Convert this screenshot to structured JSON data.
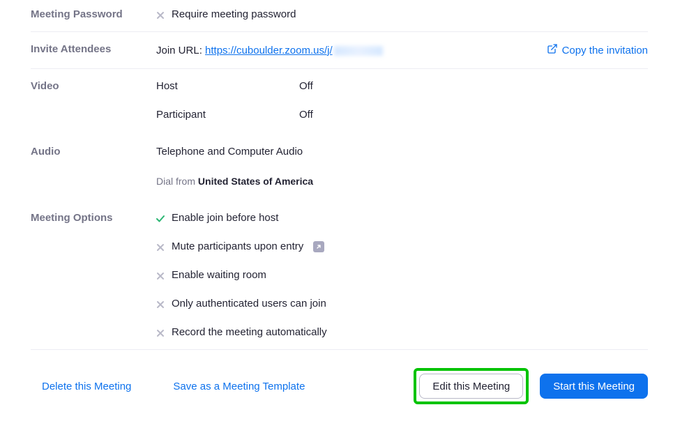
{
  "sections": {
    "meeting_password": {
      "label": "Meeting Password",
      "option": "Require meeting password"
    },
    "invite": {
      "label": "Invite Attendees",
      "join_url_label": "Join URL:",
      "join_url_visible": "https://cuboulder.zoom.us/j/",
      "copy_label": "Copy the invitation"
    },
    "video": {
      "label": "Video",
      "host_label": "Host",
      "host_value": "Off",
      "participant_label": "Participant",
      "participant_value": "Off"
    },
    "audio": {
      "label": "Audio",
      "mode": "Telephone and Computer Audio",
      "dial_from_prefix": "Dial from ",
      "dial_from_country": "United States of America"
    },
    "options": {
      "label": "Meeting Options",
      "items": [
        {
          "enabled": true,
          "text": "Enable join before host"
        },
        {
          "enabled": false,
          "text": "Mute participants upon entry",
          "info": true
        },
        {
          "enabled": false,
          "text": "Enable waiting room"
        },
        {
          "enabled": false,
          "text": "Only authenticated users can join"
        },
        {
          "enabled": false,
          "text": "Record the meeting automatically"
        }
      ]
    }
  },
  "footer": {
    "delete": "Delete this Meeting",
    "save_template": "Save as a Meeting Template",
    "edit": "Edit this Meeting",
    "start": "Start this Meeting"
  }
}
